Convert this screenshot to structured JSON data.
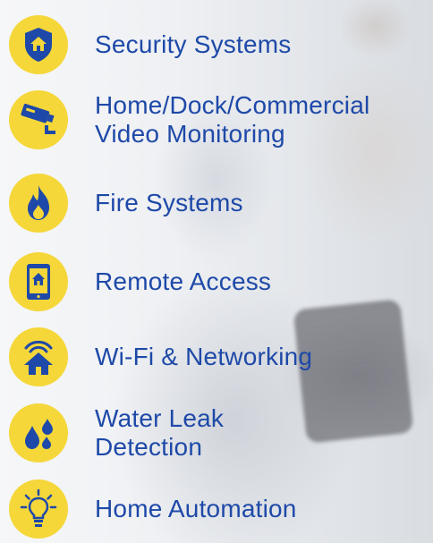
{
  "colors": {
    "accent_yellow": "#f5d73a",
    "text_blue": "#1e49a8",
    "icon_blue": "#1e49a8"
  },
  "services": [
    {
      "icon": "shield-home-icon",
      "lines": [
        "Security Systems"
      ]
    },
    {
      "icon": "security-camera-icon",
      "lines": [
        "Home/Dock/Commercial",
        "Video Monitoring"
      ]
    },
    {
      "icon": "flame-icon",
      "lines": [
        "Fire Systems"
      ]
    },
    {
      "icon": "phone-home-icon",
      "lines": [
        "Remote Access"
      ]
    },
    {
      "icon": "wifi-home-icon",
      "lines": [
        "Wi-Fi & Networking"
      ]
    },
    {
      "icon": "water-drops-icon",
      "lines": [
        "Water Leak",
        "Detection"
      ]
    },
    {
      "icon": "lightbulb-icon",
      "lines": [
        "Home Automation"
      ]
    }
  ]
}
